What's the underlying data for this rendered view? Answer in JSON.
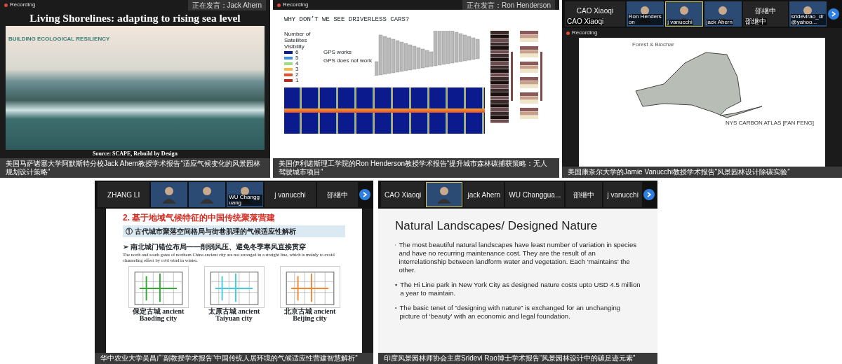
{
  "screens": [
    {
      "kind": "shoreline",
      "recording": "Recording",
      "speaker": "正在发言：Jack Ahern",
      "title": "Living Shorelines: adapting to rising sea level",
      "image_heading": "BUILDING ECOLOGICAL RESILIENCY",
      "source": "Source: SCAPE, Rebuild by Design",
      "caption": "美国马萨诸塞大学阿默斯特分校Jack Ahern教授学术报告“适应气候变化的风景园林规划设计策略”"
    },
    {
      "kind": "gps",
      "recording": "Recording",
      "speaker": "正在发言：Ron Henderson",
      "title": "WHY DON’T WE SEE DRIVERLESS CARS?",
      "legend_title": "Number of Satellites Visibility",
      "legend": [
        {
          "label": "6",
          "color": "#0a1f8f"
        },
        {
          "label": "5",
          "color": "#3b8fe8"
        },
        {
          "label": "4",
          "color": "#9be07a"
        },
        {
          "label": "3",
          "color": "#f5b942"
        },
        {
          "label": "2",
          "color": "#e8502a"
        },
        {
          "label": "1",
          "color": "#c0281e"
        }
      ],
      "works": "GPS works",
      "not_works": "GPS does not work",
      "caption": "美国伊利诺斯理工学院的Ron Henderson教授学术报告“提升城市森林碳捕获策略：无人驾驶城市项目”"
    },
    {
      "kind": "atlas",
      "participants": [
        {
          "kind": "name",
          "display": "CAO Xiaoqi",
          "label": "CAO Xiaoqi",
          "speaking": false
        },
        {
          "kind": "video",
          "label": "Ron Henderson",
          "speaking": false
        },
        {
          "kind": "video",
          "label": "j vanucchi",
          "speaking": true
        },
        {
          "kind": "video",
          "label": "jack Ahern",
          "speaking": false
        },
        {
          "kind": "name",
          "display": "邵继中",
          "label": "邵继中",
          "speaking": false
        },
        {
          "kind": "video",
          "label": "sridevirao_dr@yahoo...",
          "speaking": false
        }
      ],
      "recording": "Recording",
      "slide_title": "Forest & Biochar",
      "atlas_title": "NYS CARBON ATLAS [FAN FENG]",
      "caption": "美国康奈尔大学的Jamie Vanucchi教授学术报告“风景园林设计除碳实验”"
    },
    {
      "kind": "settlement",
      "participants": [
        {
          "kind": "name",
          "display": "ZHANG LI",
          "speaking": false
        },
        {
          "kind": "video",
          "speaking": false
        },
        {
          "kind": "video",
          "speaking": false
        },
        {
          "kind": "video",
          "label": "WU Changguang",
          "speaking": false
        },
        {
          "kind": "name",
          "display": "j vanucchi",
          "speaking": false
        },
        {
          "kind": "name",
          "display": "邵继中",
          "speaking": false
        }
      ],
      "title": "2. 基于地域气候特征的中国传统聚落营建",
      "subtitle": "①  古代城市聚落空间格局与街巷肌理的气候适应性解析",
      "point": "➢  南北城门错位布局——削弱风压、避免冬季寒风直接贯穿",
      "text": "The north and south gates of northern China ancient city are not arranged in a straight line, which is mainly to avoid channeling effect by cold wind in winter.",
      "cities": [
        "保定古城 ancient Baoding city",
        "太原古城 ancient Taiyuan city",
        "北京古城 ancient Beijing city"
      ],
      "caption": "华中农业大学吴昌广副教授学术报告“中国传统人居环境的气候适应性营建智慧解析”"
    },
    {
      "kind": "nature",
      "participants": [
        {
          "kind": "name",
          "display": "CAO Xiaoqi",
          "speaking": false
        },
        {
          "kind": "video",
          "speaking": true
        },
        {
          "kind": "name",
          "display": "jack Ahern",
          "speaking": false
        },
        {
          "kind": "name",
          "display": "WU Changgua...",
          "speaking": false
        },
        {
          "kind": "name",
          "display": "邵继中",
          "speaking": false
        },
        {
          "kind": "name",
          "display": "j vanucchi",
          "speaking": false
        }
      ],
      "title": "Natural Landscapes/ Designed Nature",
      "bullets": [
        "The most beautiful natural landscapes have least number of variation in species and have no recurring maintenance cost. They are the result of an interrelationship between landform water and vegetation. Each ‘maintains’ the other.",
        "The Hi Line park in New York City as designed nature costs upto USD 4.5 million a year to maintain.",
        "The basic tenet of “designing with nature” is exchanged for an unchanging picture of ‘beauty’ with an economic and legal foundation."
      ],
      "caption": "印度风景园林师协会主席Sridevi Rao博士学术报告“风景园林设计中的碳足迹元素”"
    }
  ]
}
